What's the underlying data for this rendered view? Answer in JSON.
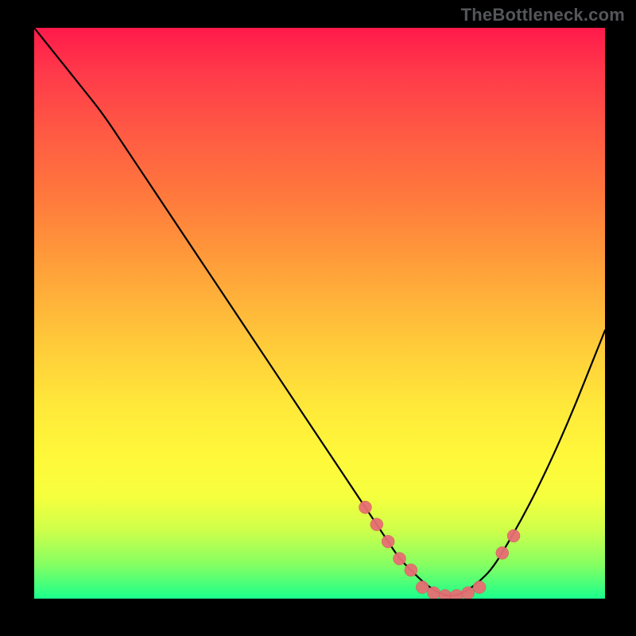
{
  "watermark": "TheBottleneck.com",
  "colors": {
    "background": "#000000",
    "watermark_text": "#555659",
    "curve_stroke": "#000000",
    "marker_fill": "#e76e73"
  },
  "chart_data": {
    "type": "line",
    "title": "",
    "xlabel": "",
    "ylabel": "",
    "xlim": [
      0,
      100
    ],
    "ylim": [
      0,
      100
    ],
    "x": [
      0,
      4,
      8,
      12,
      16,
      20,
      24,
      28,
      32,
      36,
      40,
      44,
      48,
      52,
      56,
      58,
      60,
      62,
      64,
      66,
      68,
      70,
      72,
      74,
      76,
      78,
      80,
      82,
      86,
      90,
      94,
      98,
      100
    ],
    "values": [
      100,
      95,
      90,
      85,
      79,
      73,
      67,
      61,
      55,
      49,
      43,
      37,
      31,
      25,
      19,
      16,
      13,
      10,
      7,
      5,
      3,
      1.5,
      0.5,
      0.5,
      1.5,
      3,
      5,
      8,
      15,
      23,
      32,
      42,
      47
    ],
    "markers": {
      "x": [
        58,
        60,
        62,
        64,
        66,
        68,
        70,
        72,
        74,
        76,
        78,
        82,
        84
      ],
      "values": [
        16,
        13,
        10,
        7,
        5,
        2,
        1,
        0.5,
        0.5,
        1,
        2,
        8,
        11
      ]
    }
  }
}
